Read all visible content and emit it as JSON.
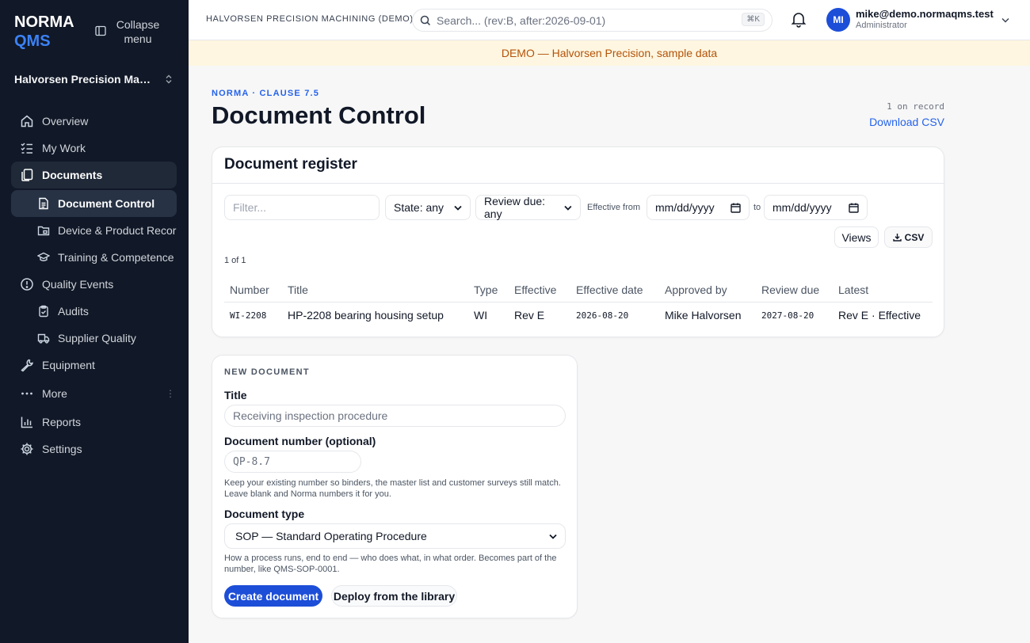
{
  "app": {
    "brand_line1": "NORMA",
    "brand_line2": "QMS",
    "collapse_label": "Collapse menu",
    "org_name": "Halvorsen Precision Machining"
  },
  "sidebar": {
    "items": [
      {
        "label": "Overview",
        "icon": "home-icon"
      },
      {
        "label": "My Work",
        "icon": "checklist-icon"
      },
      {
        "label": "Documents",
        "icon": "documents-icon"
      },
      {
        "label": "Document Control",
        "icon": "file-text-icon"
      },
      {
        "label": "Device & Product Records",
        "icon": "folder-icon"
      },
      {
        "label": "Training & Competence",
        "icon": "graduation-cap-icon"
      },
      {
        "label": "Quality Events",
        "icon": "alert-circle-icon"
      },
      {
        "label": "Audits",
        "icon": "clipboard-check-icon"
      },
      {
        "label": "Supplier Quality",
        "icon": "truck-icon"
      },
      {
        "label": "Equipment",
        "icon": "wrench-icon"
      },
      {
        "label": "More",
        "icon": "more-horizontal-icon"
      },
      {
        "label": "Reports",
        "icon": "bar-chart-icon"
      },
      {
        "label": "Settings",
        "icon": "gear-icon"
      }
    ],
    "active": "Document Control"
  },
  "topbar": {
    "company": "HALVORSEN PRECISION MACHINING (DEMO)",
    "search_placeholder": "Search... (rev:B, after:2026-09-01)",
    "search_shortcut": "⌘K",
    "avatar_initials": "MI",
    "user_email": "mike@demo.normaqms.test",
    "user_role": "Administrator"
  },
  "banner": {
    "text": "DEMO — Halvorsen Precision, sample data"
  },
  "page": {
    "eyebrow": "NORMA · CLAUSE 7.5",
    "title": "Document Control",
    "record_count": "1 on record",
    "download_label": "Download CSV"
  },
  "register": {
    "title": "Document register",
    "filter_placeholder": "Filter...",
    "state_select": "State: any",
    "review_select": "Review due: any",
    "effective_from_label": "Effective from",
    "date_placeholder": "mm/dd/yyyy",
    "to_label": "to",
    "views_label": "Views",
    "csv_label": "CSV",
    "count": "1 of 1",
    "columns": [
      "Number",
      "Title",
      "Type",
      "Effective",
      "Effective date",
      "Approved by",
      "Review due",
      "Latest"
    ],
    "rows": [
      {
        "number": "WI-2208",
        "title": "HP-2208 bearing housing setup",
        "type": "WI",
        "effective": "Rev E",
        "effective_date": "2026-08-20",
        "approved_by": "Mike Halvorsen",
        "review_due": "2027-08-20",
        "latest": "Rev E · Effective"
      }
    ]
  },
  "new_document": {
    "eyebrow": "NEW DOCUMENT",
    "title_label": "Title",
    "title_placeholder": "Receiving inspection procedure",
    "number_label": "Document number (optional)",
    "number_placeholder": "QP-8.7",
    "number_help": "Keep your existing number so binders, the master list and customer surveys still match. Leave blank and Norma numbers it for you.",
    "type_label": "Document type",
    "type_value": "SOP — Standard Operating Procedure",
    "type_help": "How a process runs, end to end — who does what, in what order. Becomes part of the number, like QMS-SOP-0001.",
    "create_label": "Create document",
    "deploy_label": "Deploy from the library"
  },
  "colors": {
    "sidebar_bg": "#111827",
    "accent": "#2563eb",
    "primary_button": "#1d4ed8",
    "banner_bg": "#fef6e0",
    "banner_text": "#b45309"
  }
}
